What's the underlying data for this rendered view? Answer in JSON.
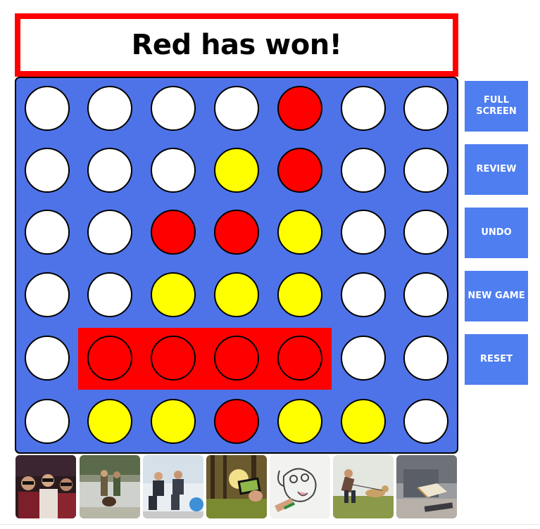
{
  "status": {
    "text": "Red has won!"
  },
  "colors": {
    "empty": "#ffffff",
    "red": "#ff0000",
    "yellow": "#ffff00",
    "board": "#4e73e8",
    "button": "#4f7ef0"
  },
  "board": {
    "rows": 6,
    "cols": 7,
    "cells": [
      [
        "empty",
        "empty",
        "empty",
        "empty",
        "red",
        "empty",
        "empty"
      ],
      [
        "empty",
        "empty",
        "empty",
        "yellow",
        "red",
        "empty",
        "empty"
      ],
      [
        "empty",
        "empty",
        "red",
        "red",
        "yellow",
        "empty",
        "empty"
      ],
      [
        "empty",
        "empty",
        "yellow",
        "yellow",
        "yellow",
        "empty",
        "empty"
      ],
      [
        "empty",
        "red",
        "red",
        "red",
        "red",
        "empty",
        "empty"
      ],
      [
        "empty",
        "yellow",
        "yellow",
        "red",
        "yellow",
        "yellow",
        "empty"
      ]
    ],
    "winning_line": {
      "row": 5,
      "from_col": 2,
      "to_col": 5
    }
  },
  "sidebar": {
    "buttons": [
      {
        "id": "full-screen",
        "label": "FULL\nSCREEN"
      },
      {
        "id": "review",
        "label": "REVIEW"
      },
      {
        "id": "undo",
        "label": "UNDO"
      },
      {
        "id": "new-game",
        "label": "NEW GAME"
      },
      {
        "id": "reset",
        "label": "RESET"
      }
    ]
  },
  "thumbnails": [
    {
      "name": "cinema-audience"
    },
    {
      "name": "bear-and-photographers"
    },
    {
      "name": "fitness-class"
    },
    {
      "name": "phone-in-forest"
    },
    {
      "name": "dog-drawing"
    },
    {
      "name": "dog-training"
    },
    {
      "name": "person-reading-book"
    }
  ]
}
